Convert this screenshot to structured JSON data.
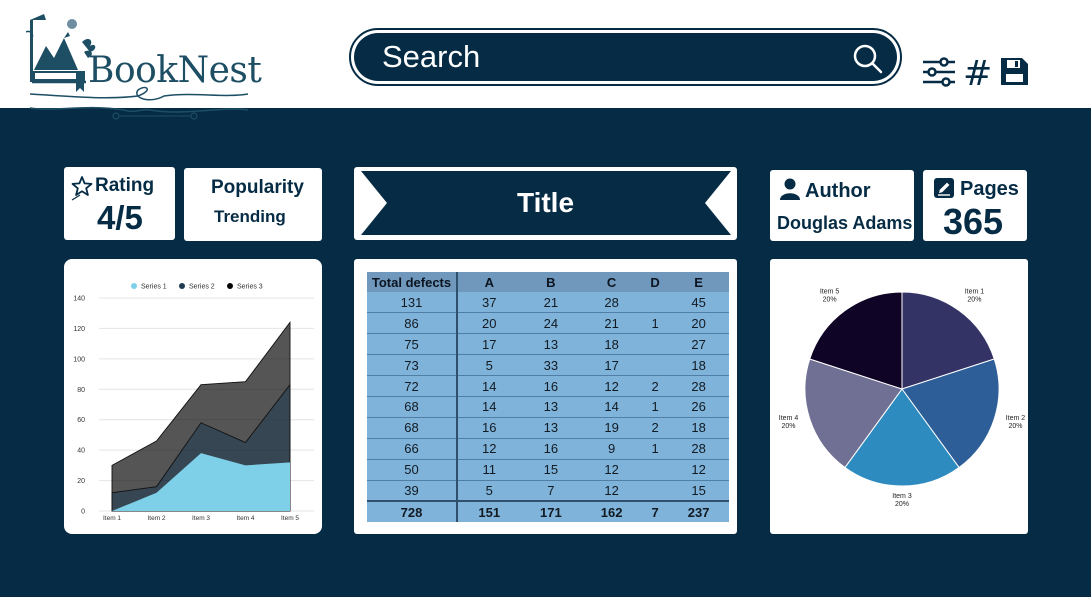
{
  "brand": {
    "name": "BookNest"
  },
  "search": {
    "placeholder": "Search"
  },
  "toolbar": {
    "hash_label": "#"
  },
  "cards": {
    "rating": {
      "label": "Rating",
      "value": "4/5"
    },
    "popularity": {
      "label": "Popularity",
      "value": "Trending"
    },
    "title": {
      "label": "Title"
    },
    "author": {
      "label": "Author",
      "value": "Douglas Adams"
    },
    "pages": {
      "label": "Pages",
      "value": "365"
    }
  },
  "colors": {
    "background": "#062c45",
    "accent": "#062c45",
    "card": "#ffffff"
  },
  "icons": [
    "search-icon",
    "sliders-icon",
    "save-icon",
    "star-icon",
    "user-icon",
    "edit-icon"
  ],
  "chart_data": [
    {
      "type": "area",
      "categories": [
        "Item 1",
        "Item 2",
        "Item 3",
        "Item 4",
        "Item 5"
      ],
      "series": [
        {
          "name": "Series 1",
          "values": [
            0,
            12,
            38,
            30,
            32
          ],
          "color": "#7ecfe8"
        },
        {
          "name": "Series 2",
          "values": [
            12,
            16,
            58,
            45,
            83
          ],
          "color": "#1e3b52"
        },
        {
          "name": "Series 3",
          "values": [
            30,
            46,
            83,
            85,
            124
          ],
          "color": "#050505"
        }
      ],
      "yticks": [
        0,
        20,
        40,
        60,
        80,
        100,
        120,
        140
      ],
      "ylim": [
        0,
        140
      ],
      "grid": true,
      "legend": "top"
    },
    {
      "type": "table",
      "columns": [
        "Total defects",
        "A",
        "B",
        "C",
        "D",
        "E"
      ],
      "rows": [
        [
          "131",
          "37",
          "21",
          "28",
          "",
          "45"
        ],
        [
          "86",
          "20",
          "24",
          "21",
          "1",
          "20"
        ],
        [
          "75",
          "17",
          "13",
          "18",
          "",
          "27"
        ],
        [
          "73",
          "5",
          "33",
          "17",
          "",
          "18"
        ],
        [
          "72",
          "14",
          "16",
          "12",
          "2",
          "28"
        ],
        [
          "68",
          "14",
          "13",
          "14",
          "1",
          "26"
        ],
        [
          "68",
          "16",
          "13",
          "19",
          "2",
          "18"
        ],
        [
          "66",
          "12",
          "16",
          "9",
          "1",
          "28"
        ],
        [
          "50",
          "11",
          "15",
          "12",
          "",
          "12"
        ],
        [
          "39",
          "5",
          "7",
          "12",
          "",
          "15"
        ]
      ],
      "totals": [
        "728",
        "151",
        "171",
        "162",
        "7",
        "237"
      ]
    },
    {
      "type": "pie",
      "slices": [
        {
          "label": "Item 1",
          "pct": "20%",
          "value": 20,
          "color": "#333366"
        },
        {
          "label": "Item 2",
          "pct": "20%",
          "value": 20,
          "color": "#2e5e98"
        },
        {
          "label": "Item 3",
          "pct": "20%",
          "value": 20,
          "color": "#2d8bbf"
        },
        {
          "label": "Item 4",
          "pct": "20%",
          "value": 20,
          "color": "#707094"
        },
        {
          "label": "Item 5",
          "pct": "20%",
          "value": 20,
          "color": "#0f0326"
        }
      ]
    }
  ]
}
